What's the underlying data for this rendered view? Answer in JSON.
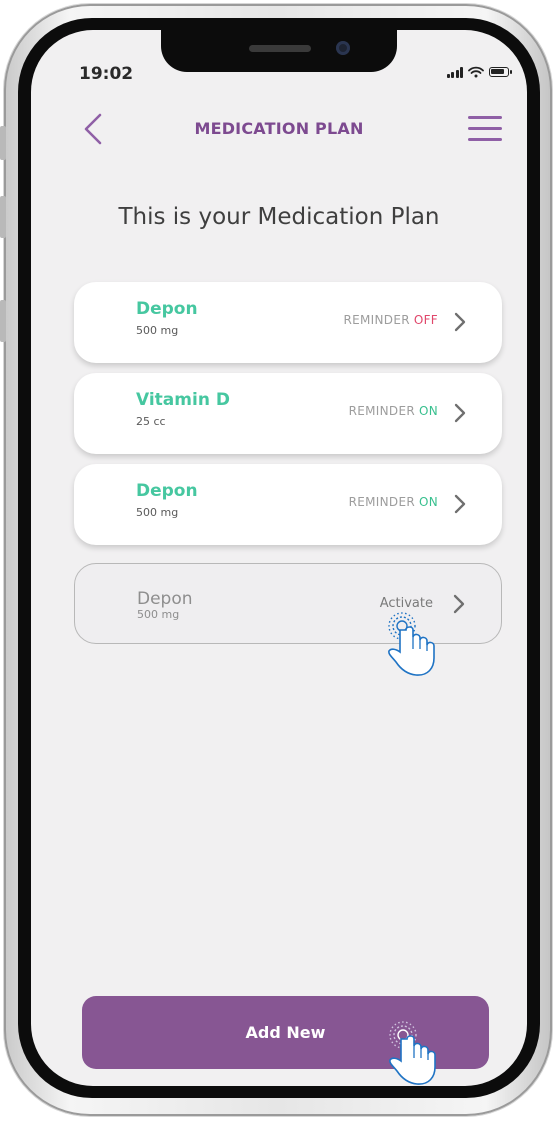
{
  "status_bar": {
    "time": "19:02"
  },
  "header": {
    "title": "MEDICATION PLAN"
  },
  "heading": "This is your Medication Plan",
  "medications": [
    {
      "name": "Depon",
      "dose": "500 mg",
      "reminder_label": "REMINDER",
      "reminder_state": "OFF"
    },
    {
      "name": "Vitamin D",
      "dose": "25 cc",
      "reminder_label": "REMINDER",
      "reminder_state": "ON"
    },
    {
      "name": "Depon",
      "dose": "500 mg",
      "reminder_label": "REMINDER",
      "reminder_state": "ON"
    },
    {
      "name": "Depon",
      "dose": "500 mg",
      "action_label": "Activate"
    }
  ],
  "add_button": {
    "label": "Add New"
  },
  "colors": {
    "brand_purple": "#875693",
    "title_purple": "#7d4a90",
    "med_name_green": "#46c7a0",
    "reminder_off": "#e0476b",
    "reminder_on": "#39c08f",
    "screen_bg": "#f1f0f1"
  },
  "icons": [
    "back-chevron-icon",
    "hamburger-menu-icon",
    "chevron-right-icon",
    "signal-icon",
    "wifi-icon",
    "battery-icon",
    "tap-hand-icon"
  ]
}
